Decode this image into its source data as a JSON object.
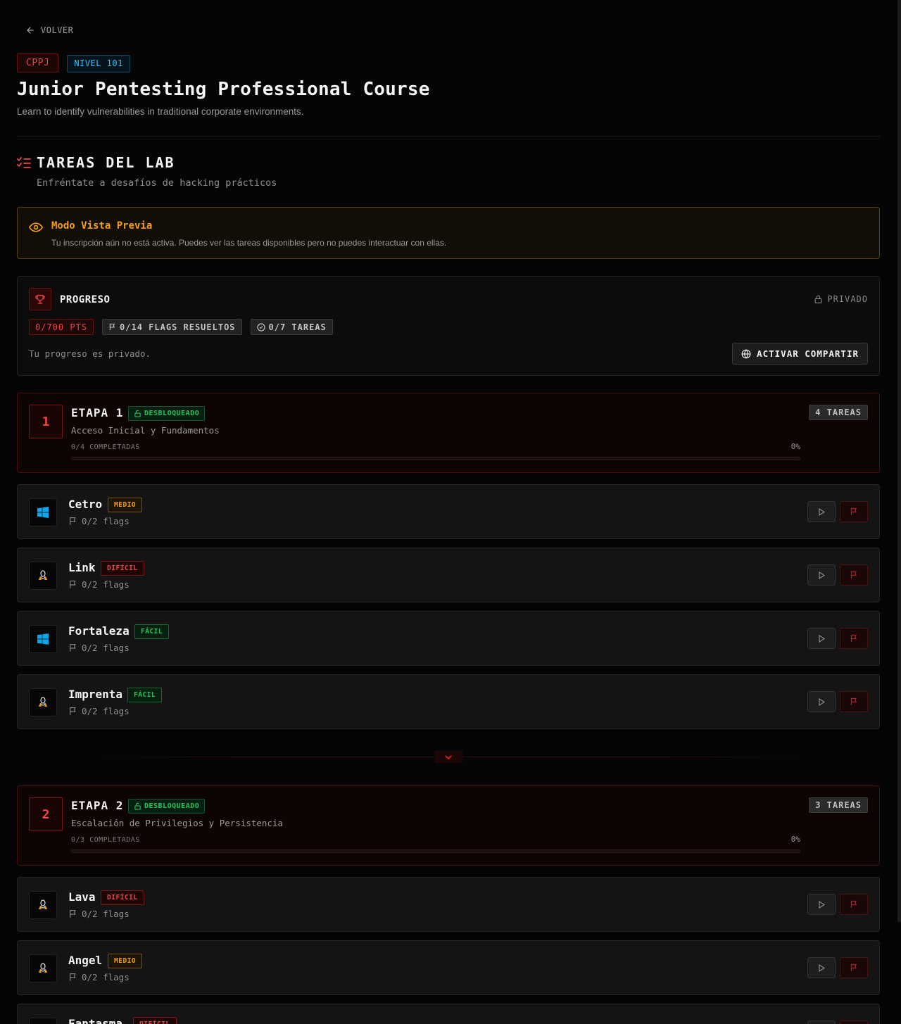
{
  "nav": {
    "back_label": "VOLVER"
  },
  "course": {
    "code": "CPPJ",
    "level": "NIVEL 101",
    "title": "Junior Pentesting Professional Course",
    "subtitle": "Learn to identify vulnerabilities in traditional corporate environments."
  },
  "section": {
    "title": "TAREAS DEL LAB",
    "subtitle": "Enfréntate a desafíos de hacking prácticos"
  },
  "preview": {
    "title": "Modo Vista Previa",
    "text": "Tu inscripción aún no está activa. Puedes ver las tareas disponibles pero no puedes interactuar con ellas."
  },
  "progress": {
    "title": "PROGRESO",
    "visibility": "PRIVADO",
    "points": "0/700 PTS",
    "flags": "0/14 FLAGS RESUELTOS",
    "tasks": "0/7 TAREAS",
    "privacy_text": "Tu progreso es privado.",
    "share_label": "ACTIVAR COMPARTIR"
  },
  "colors": {
    "accent_red": "#ef4444",
    "unlocked_green": "#22c55e",
    "warning_amber": "#f59e0b",
    "level_blue": "#38bdf8"
  },
  "stages": [
    {
      "number": "1",
      "title": "ETAPA 1",
      "status": "DESBLOQUEADO",
      "description": "Acceso Inicial y Fundamentos",
      "completed_text": "0/4 COMPLETADAS",
      "percent_text": "0%",
      "progress": 0,
      "tasks_badge": "4 TAREAS"
    },
    {
      "number": "2",
      "title": "ETAPA 2",
      "status": "DESBLOQUEADO",
      "description": "Escalación de Privilegios y Persistencia",
      "completed_text": "0/3 COMPLETADAS",
      "percent_text": "0%",
      "progress": 0,
      "tasks_badge": "3 TAREAS"
    }
  ],
  "tasks": [
    {
      "name": "Cetro",
      "difficulty": "MEDIO",
      "flags": "0/2 flags",
      "os": "windows-icon"
    },
    {
      "name": "Link",
      "difficulty": "DIFÍCIL",
      "flags": "0/2 flags",
      "os": "linux-icon"
    },
    {
      "name": "Fortaleza",
      "difficulty": "FÁCIL",
      "flags": "0/2 flags",
      "os": "windows-icon"
    },
    {
      "name": "Imprenta",
      "difficulty": "FÁCIL",
      "flags": "0/2 flags",
      "os": "linux-icon"
    },
    {
      "name": "Lava",
      "difficulty": "DIFÍCIL",
      "flags": "0/2 flags",
      "os": "linux-icon"
    },
    {
      "name": "Angel",
      "difficulty": "MEDIO",
      "flags": "0/2 flags",
      "os": "linux-icon"
    },
    {
      "name": "Fantasma",
      "difficulty": "DIFÍCIL",
      "flags": "",
      "os": "linux-icon"
    }
  ]
}
